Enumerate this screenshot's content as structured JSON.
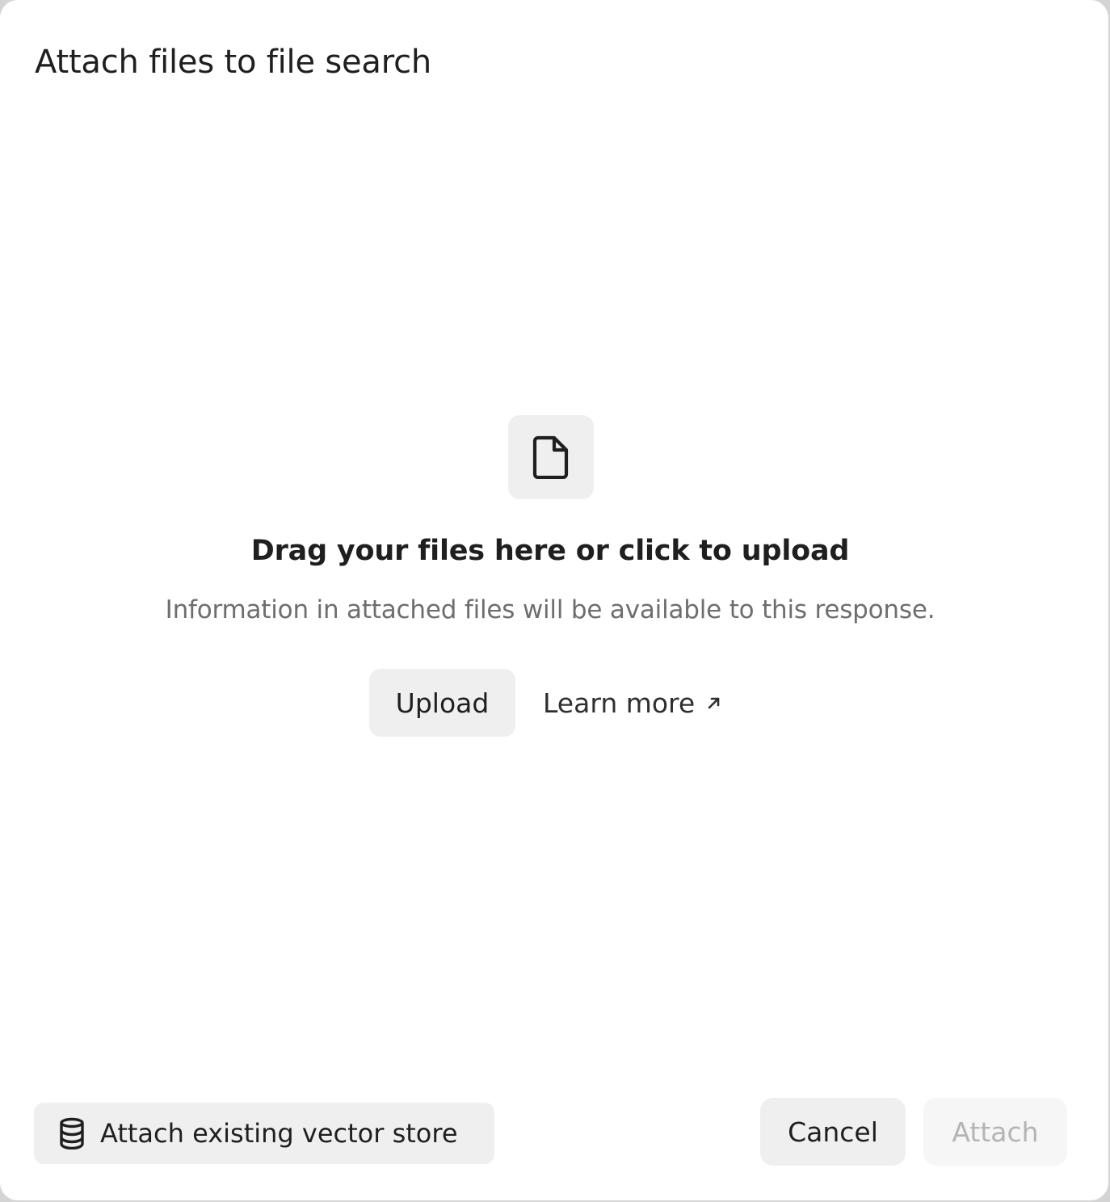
{
  "dialog": {
    "title": "Attach files to file search"
  },
  "dropzone": {
    "icon": "file-icon",
    "headline": "Drag your files here or click to upload",
    "subtext": "Information in attached files will be available to this response.",
    "upload_label": "Upload",
    "learn_more_label": "Learn more",
    "learn_more_icon": "external-arrow-icon"
  },
  "footer": {
    "vector_store_icon": "database-icon",
    "vector_store_label": "Attach existing vector store",
    "cancel_label": "Cancel",
    "attach_label": "Attach",
    "attach_disabled": true
  },
  "colors": {
    "text_primary": "#1f1f1f",
    "text_secondary": "#6e6e6e",
    "button_bg": "#efefef",
    "disabled_text": "#b4b4b4"
  }
}
